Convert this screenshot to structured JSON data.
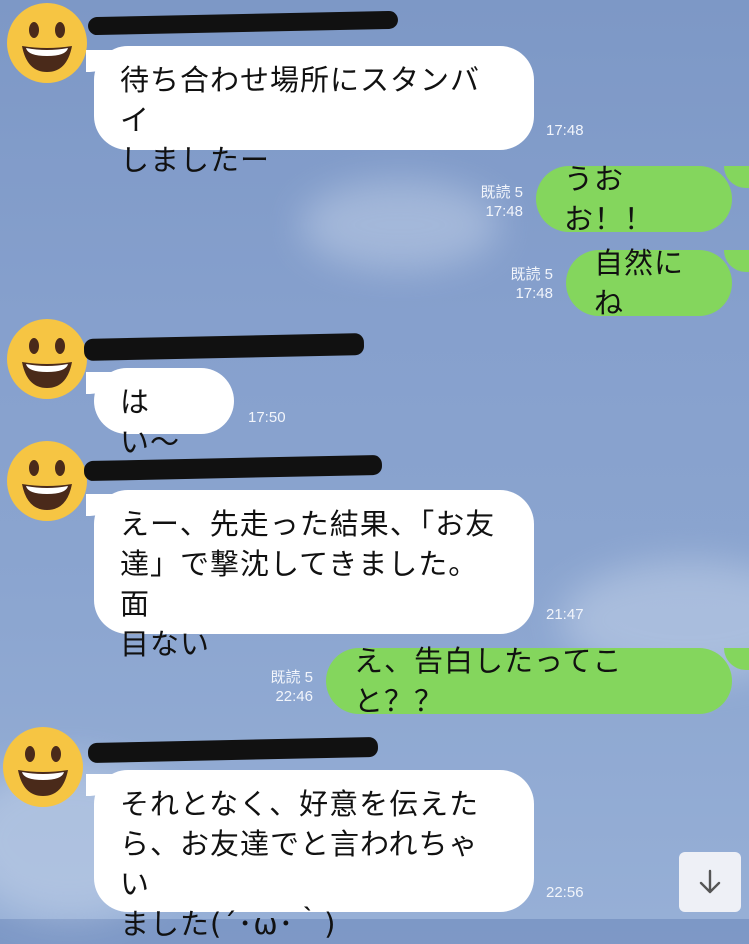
{
  "colors": {
    "background": "#86a0cd",
    "incoming_bubble": "#ffffff",
    "outgoing_bubble": "#84d65d",
    "avatar": "#f6c543"
  },
  "icons": {
    "avatar": "smiley-face-icon",
    "scroll": "arrow-down-icon"
  },
  "messages": [
    {
      "direction": "in",
      "text": "待ち合わせ場所にスタンバイ\nしましたー",
      "time": "17:48"
    },
    {
      "direction": "out",
      "text": "うおお！！",
      "read": "既読 5",
      "time": "17:48"
    },
    {
      "direction": "out",
      "text": "自然にね",
      "read": "既読 5",
      "time": "17:48"
    },
    {
      "direction": "in",
      "text": "はい〜",
      "time": "17:50"
    },
    {
      "direction": "in",
      "text": "えー、先走った結果、「お友\n達」で撃沈してきました。面\n目ない",
      "time": "21:47"
    },
    {
      "direction": "out",
      "text": "え、告白したってこと？？",
      "read": "既読 5",
      "time": "22:46"
    },
    {
      "direction": "in",
      "text": "それとなく、好意を伝えた\nら、お友達でと言われちゃい\nました(´･ω･｀)",
      "time": "22:56"
    }
  ]
}
